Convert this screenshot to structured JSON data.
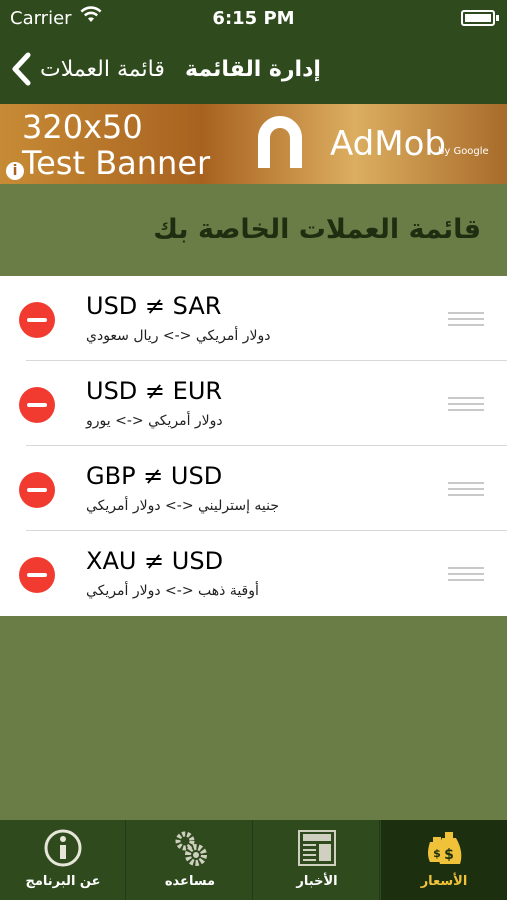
{
  "status_bar": {
    "carrier": "Carrier",
    "time": "6:15 PM"
  },
  "nav": {
    "back_label": "قائمة العملات",
    "title": "إدارة القائمة"
  },
  "banner": {
    "line1": "320x50",
    "line2": "Test Banner",
    "brand": "AdMob",
    "by": "by Google"
  },
  "section_title": "قائمة العملات الخاصة بك",
  "rows": [
    {
      "pair": "USD ≠ SAR",
      "names": "دولار أمريكي <-> ريال سعودي"
    },
    {
      "pair": "USD ≠ EUR",
      "names": "دولار أمريكي <-> يورو"
    },
    {
      "pair": "GBP ≠ USD",
      "names": "جنيه إسترليني <-> دولار أمريكي"
    },
    {
      "pair": "XAU ≠ USD",
      "names": "أوقية ذهب <-> دولار أمريكي"
    }
  ],
  "tabs": [
    {
      "label": "عن البرنامج",
      "icon": "info-icon"
    },
    {
      "label": "مساعده",
      "icon": "gears-icon"
    },
    {
      "label": "الأخبار",
      "icon": "news-icon"
    },
    {
      "label": "الأسعار",
      "icon": "money-bags-icon"
    }
  ],
  "colors": {
    "bar": "#2f4b1e",
    "background": "#6b7d46",
    "delete": "#f23b30",
    "active_tab_label": "#f0c23a"
  }
}
